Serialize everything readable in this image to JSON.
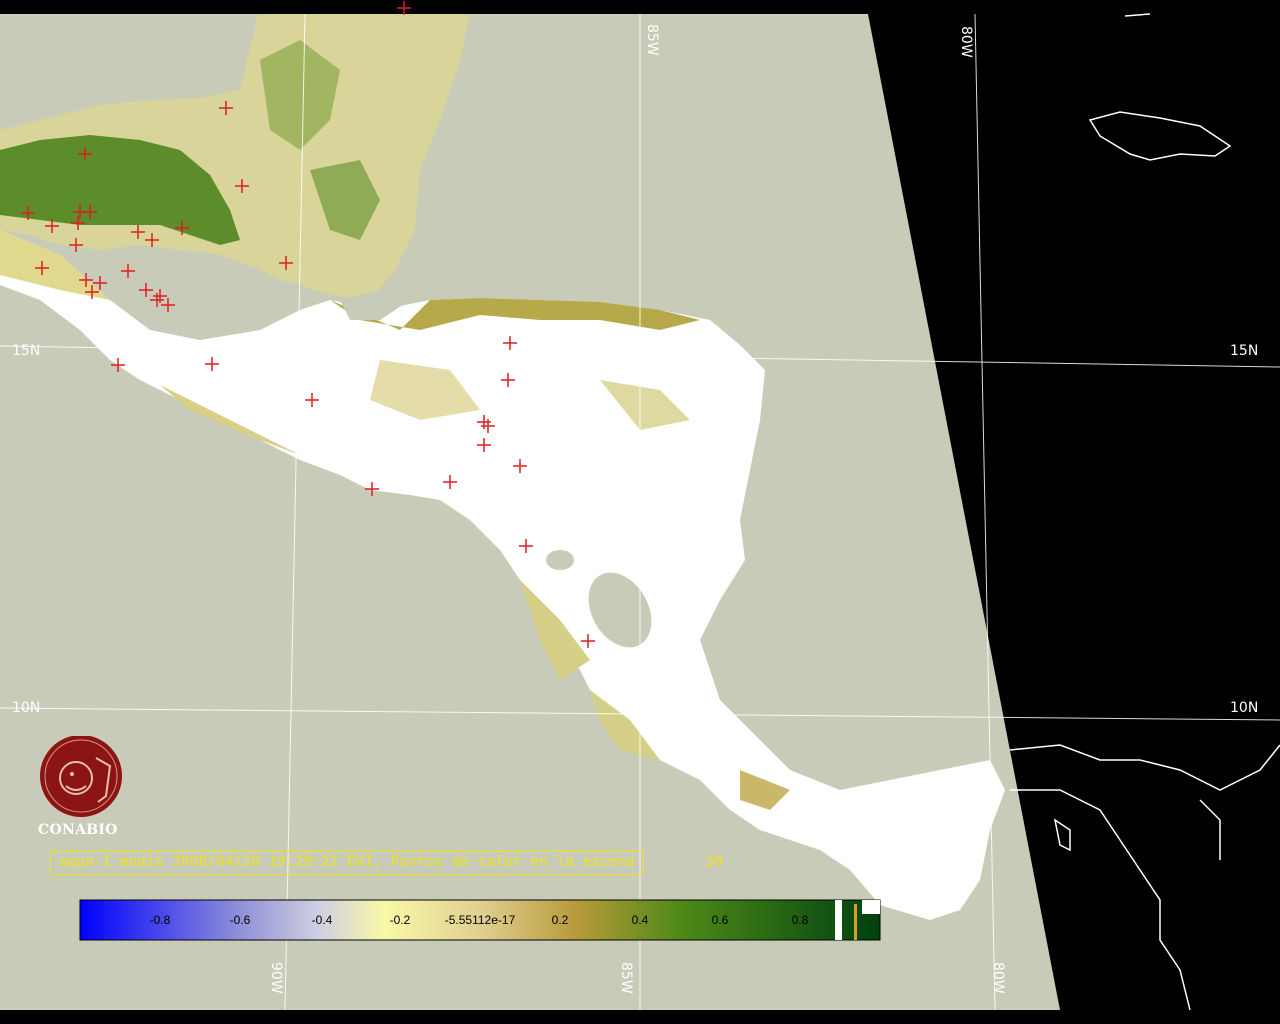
{
  "map": {
    "title_bar_color": "#000000",
    "background_land_mask": "#c8cbb8",
    "space_color": "#000000",
    "grid_labels": {
      "lat_15_left": "15N",
      "lat_15_right": "15N",
      "lat_10_left": "10N",
      "lat_10_right": "10N",
      "lon_85_top": "85W",
      "lon_80_top": "80W",
      "lon_90_bottom": "90W",
      "lon_85_bottom": "85W",
      "lon_80_bottom": "80W"
    },
    "hotspot_marker_color": "#dd1f1f"
  },
  "caption": {
    "text": "aqua-1 modis 2008/04/20 19:29:22 EVI, Puntos de calor en la escena",
    "count": "50"
  },
  "logo": {
    "name": "CONABIO",
    "icon": "conabio-logo-icon"
  },
  "colorbar": {
    "ticks": [
      "-0.8",
      "-0.6",
      "-0.4",
      "-0.2",
      "-5.55112e-17",
      "0.2",
      "0.4",
      "0.6",
      "0.8"
    ],
    "colors": {
      "low": "#0000ff",
      "mid_neg": "#c0c0d8",
      "zero": "#f5f5a0",
      "mid_pos": "#b8a040",
      "high": "#005010"
    }
  }
}
